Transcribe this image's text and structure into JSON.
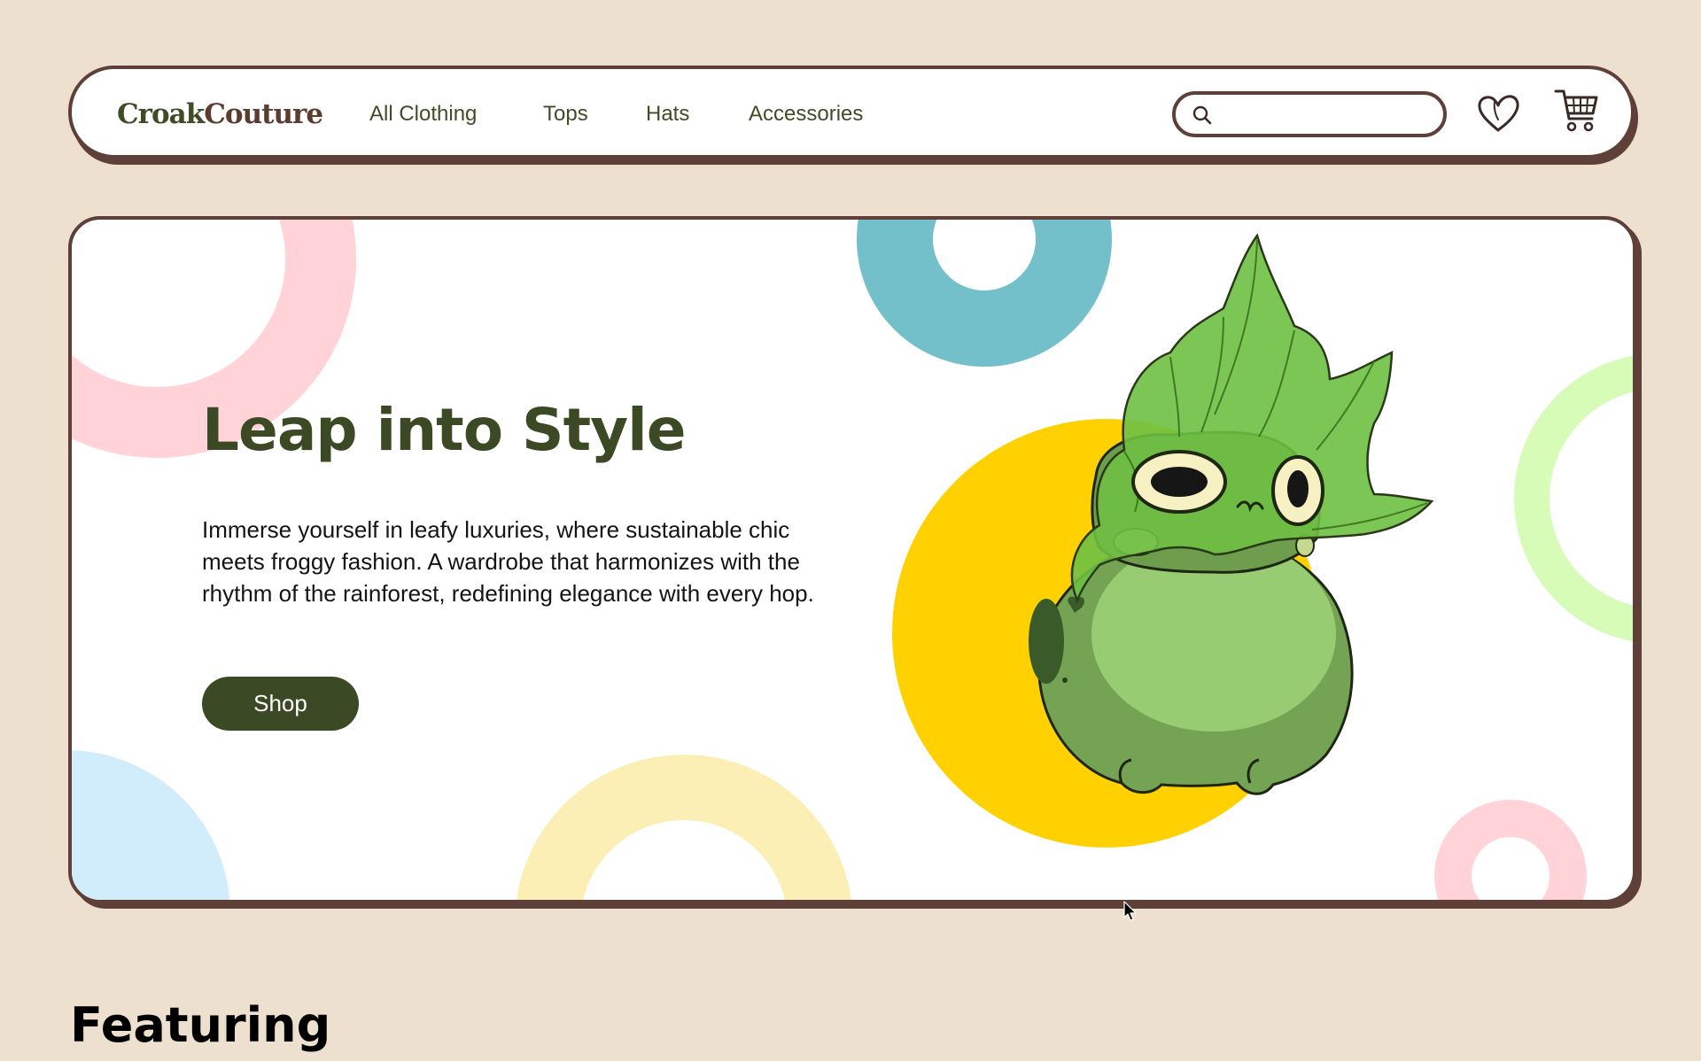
{
  "brand": {
    "name_part_1": "Croak",
    "name_part_2": "Couture"
  },
  "nav": {
    "links": [
      {
        "label": "All Clothing"
      },
      {
        "label": "Tops"
      },
      {
        "label": "Hats"
      },
      {
        "label": "Accessories"
      }
    ],
    "search_placeholder": "",
    "icons": [
      "search-icon",
      "heart-icon",
      "cart-icon"
    ]
  },
  "hero": {
    "title": "Leap into Style",
    "body": "Immerse yourself in leafy luxuries, where sustainable chic meets froggy fashion. A wardrobe that harmonizes with the rhythm of the rainforest, redefining elegance with every hop.",
    "cta_label": "Shop",
    "illustration": "frog-with-leaf-hat"
  },
  "featured": {
    "title": "Featuring"
  },
  "colors": {
    "background": "#ede0cf",
    "outline": "#5e4039",
    "brand_green": "#3b4925",
    "accent_yellow": "#ffd100",
    "accent_teal": "#74c0ca",
    "accent_pink": "#ffd3d8",
    "accent_light_green": "#d7fcb8",
    "accent_light_blue": "#d1edfc",
    "accent_pale_yellow": "#fcefb5"
  }
}
